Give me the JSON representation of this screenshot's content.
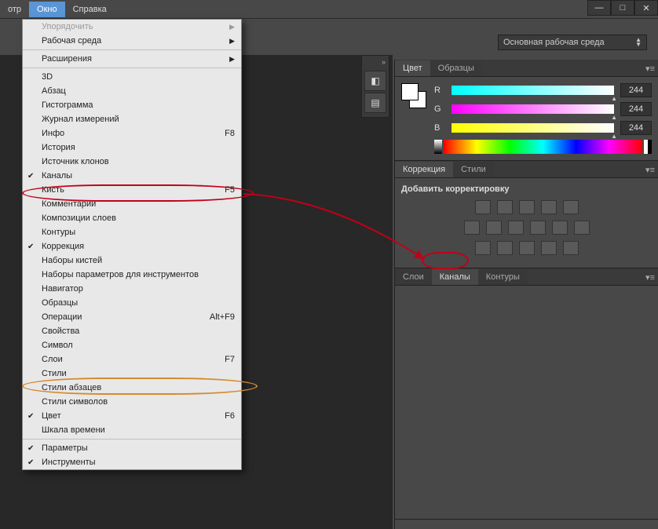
{
  "menubar": {
    "items": [
      "отр",
      "Окно",
      "Справка"
    ],
    "active_index": 1
  },
  "win_controls": {
    "min": "—",
    "max": "□",
    "close": "✕"
  },
  "workspace": {
    "label": "Основная рабочая среда"
  },
  "dropdown": {
    "groups": [
      [
        {
          "label": "Упорядочить",
          "disabled": true,
          "submenu": true
        },
        {
          "label": "Рабочая среда",
          "submenu": true
        }
      ],
      [
        {
          "label": "Расширения",
          "submenu": true
        }
      ],
      [
        {
          "label": "3D"
        },
        {
          "label": "Абзац"
        },
        {
          "label": "Гистограмма"
        },
        {
          "label": "Журнал измерений"
        },
        {
          "label": "Инфо",
          "shortcut": "F8"
        },
        {
          "label": "История"
        },
        {
          "label": "Источник клонов"
        },
        {
          "label": "Каналы",
          "checked": true
        },
        {
          "label": "Кисть",
          "shortcut": "F5"
        },
        {
          "label": "Комментарии"
        },
        {
          "label": "Композиции слоев"
        },
        {
          "label": "Контуры"
        },
        {
          "label": "Коррекция",
          "checked": true
        },
        {
          "label": "Наборы кистей"
        },
        {
          "label": "Наборы параметров для инструментов"
        },
        {
          "label": "Навигатор"
        },
        {
          "label": "Образцы"
        },
        {
          "label": "Операции",
          "shortcut": "Alt+F9"
        },
        {
          "label": "Свойства"
        },
        {
          "label": "Символ"
        },
        {
          "label": "Слои",
          "shortcut": "F7"
        },
        {
          "label": "Стили"
        },
        {
          "label": "Стили абзацев"
        },
        {
          "label": "Стили символов"
        },
        {
          "label": "Цвет",
          "shortcut": "F6",
          "checked": true
        },
        {
          "label": "Шкала времени"
        }
      ],
      [
        {
          "label": "Параметры",
          "checked": true
        },
        {
          "label": "Инструменты",
          "checked": true
        }
      ]
    ]
  },
  "color_panel": {
    "tabs": [
      "Цвет",
      "Образцы"
    ],
    "channels": [
      {
        "label": "R",
        "value": "244"
      },
      {
        "label": "G",
        "value": "244"
      },
      {
        "label": "B",
        "value": "244"
      }
    ]
  },
  "adjust_panel": {
    "tabs": [
      "Коррекция",
      "Стили"
    ],
    "heading": "Добавить корректировку"
  },
  "layers_panel": {
    "tabs": [
      "Слои",
      "Каналы",
      "Контуры"
    ],
    "active_index": 1
  }
}
